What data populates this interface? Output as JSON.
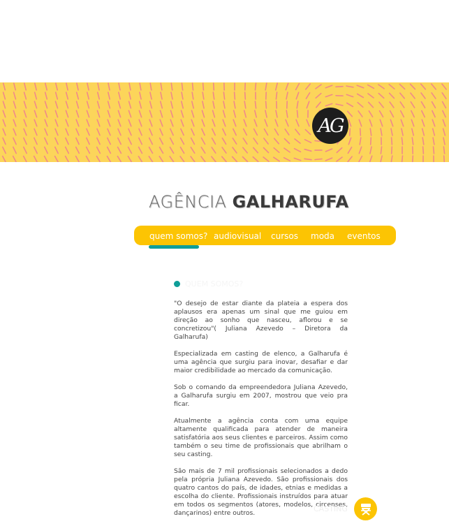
{
  "logo": {
    "text": "AG"
  },
  "header": {
    "title_light": "AGÊNCIA",
    "title_bold": "GALHARUFA"
  },
  "nav": {
    "items": [
      {
        "label": "quem somos?",
        "active": true
      },
      {
        "label": "audiovisual"
      },
      {
        "label": "cursos"
      },
      {
        "label": "moda"
      },
      {
        "label": "eventos"
      }
    ]
  },
  "section": {
    "heading": "QUEM SOMOS?"
  },
  "content": {
    "paragraphs": [
      "\"O desejo de estar diante da plateia a espera dos aplausos era apenas um sinal que me guiou em direção ao sonho que nasceu, aflorou e se concretizou\"( Juliana Azevedo – Diretora da Galharufa)",
      "Especializada em casting de elenco, a Galharufa é uma agência que surgiu para inovar, desafiar e dar maior credibilidade ao mercado da comunicação.",
      "Sob o comando da empreendedora Juliana Azevedo, a Galharufa surgiu em 2007, mostrou que veio pra ficar.",
      "Atualmente a agência conta com uma equipe altamente qualificada para atender de maneira satisfatória aos seus clientes e parceiros. Assim como também o seu time de profissionais que abrilham o seu casting.",
      "São mais de 7 mil profissionais selecionados a dedo pela própria Juliana Azevedo. São profissionais dos quatro cantos do país, de idades, etnias e medidas a escolha do cliente. Profissionais instruídos para atuar em todos os segmentos (atores, modelos, circenses, dançarinos) entre outros."
    ]
  },
  "footer": {
    "casting_label": "CASTING"
  },
  "colors": {
    "banner": "#fcd55a",
    "nav": "#fcc403",
    "accent": "#0f9e98",
    "stroke": "#f08a8a"
  },
  "icons": {
    "banner_pattern": "dash-pattern",
    "casting": "director-chair-icon"
  }
}
